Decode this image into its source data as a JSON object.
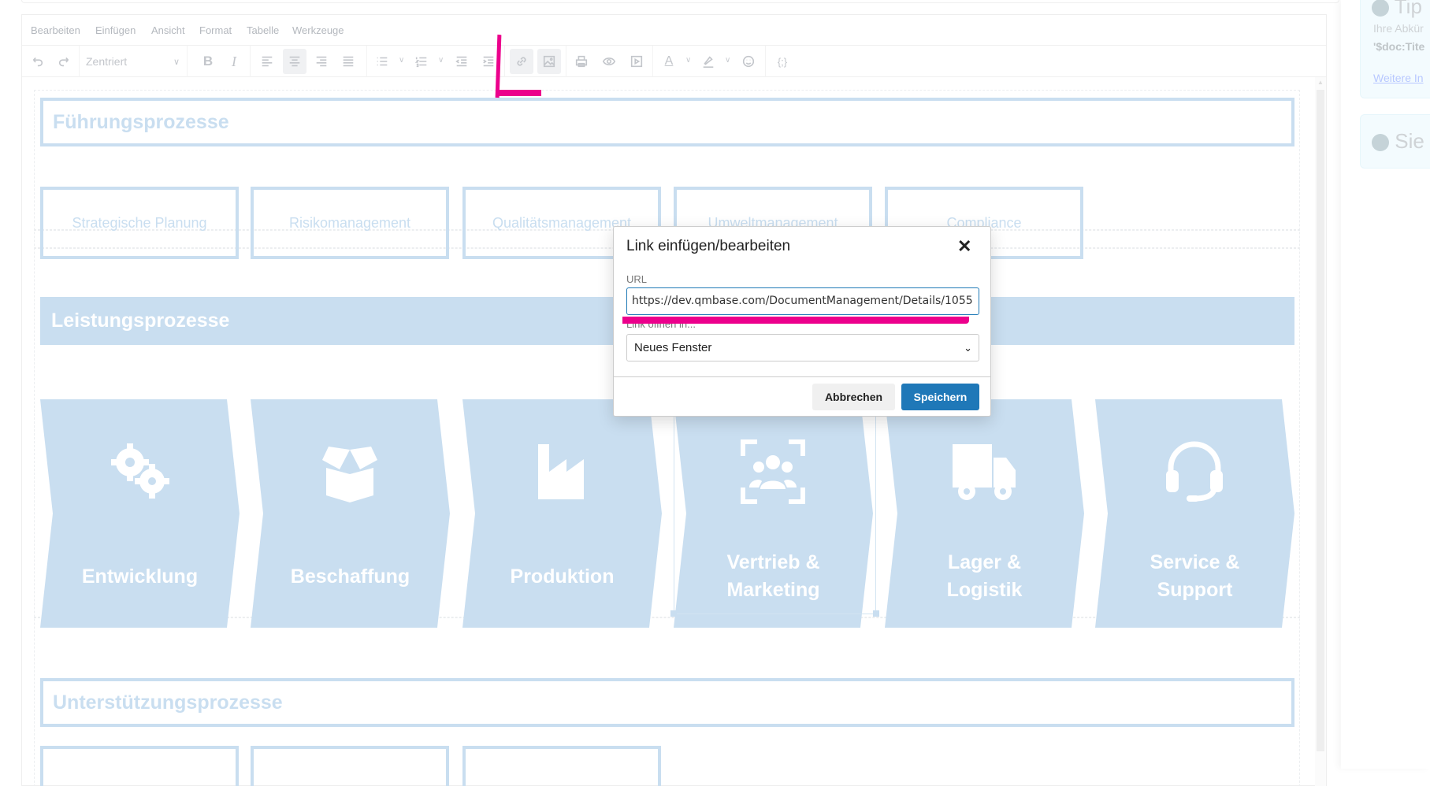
{
  "menubar": {
    "items": [
      "Bearbeiten",
      "Einfügen",
      "Ansicht",
      "Format",
      "Tabelle",
      "Werkzeuge"
    ]
  },
  "toolbar": {
    "format_select": "Zentriert"
  },
  "content": {
    "heading1": "Führungsprozesse",
    "management": [
      "Strategische Planung",
      "Risikomanagement",
      "Qualitätsmanagement",
      "Umweltmanagement",
      "Compliance"
    ],
    "heading2": "Leistungsprozesse",
    "core": [
      {
        "label": "Entwicklung",
        "icon": "gears-icon"
      },
      {
        "label": "Beschaffung",
        "icon": "box-open-icon"
      },
      {
        "label": "Produktion",
        "icon": "factory-icon"
      },
      {
        "label": "Vertrieb &\nMarketing",
        "icon": "users-viewfinder-icon"
      },
      {
        "label": "Lager &\nLogistik",
        "icon": "truck-icon"
      },
      {
        "label": "Service &\nSupport",
        "icon": "headset-icon"
      }
    ],
    "heading3": "Unterstützungsprozesse"
  },
  "sidebar": {
    "tip_title": "Tip",
    "tip_line1": "Ihre Abkür",
    "tip_line2": "'$doc:Tite",
    "tip_link": "Weitere In",
    "info_title": "Sie a"
  },
  "dialog": {
    "title": "Link einfügen/bearbeiten",
    "url_label": "URL",
    "url_value": "https://dev.qmbase.com/DocumentManagement/Details/1055",
    "target_label": "Link öffnen in...",
    "target_value": "Neues Fenster",
    "cancel": "Abbrechen",
    "save": "Speichern"
  },
  "colors": {
    "accent": "#1f78b8",
    "process": "#c9def0",
    "annotation": "#ec008c"
  }
}
